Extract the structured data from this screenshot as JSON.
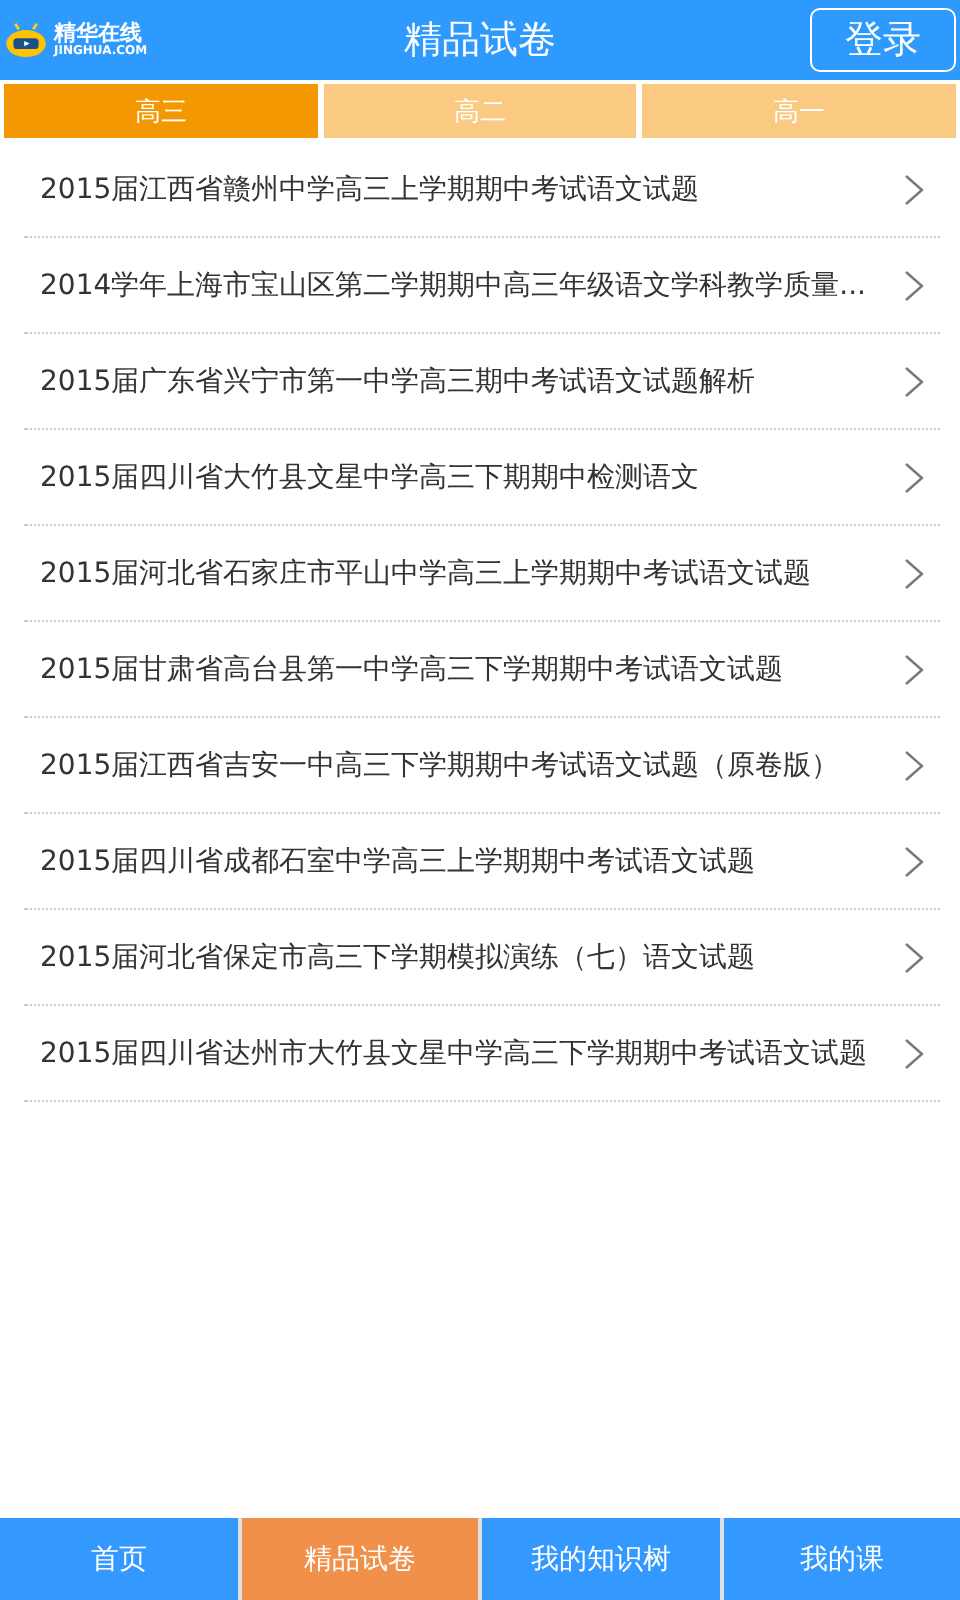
{
  "header": {
    "logo_name": "精华在线",
    "logo_domain": "JINGHUA.COM",
    "title": "精品试卷",
    "login_button": "登录"
  },
  "tabs": [
    {
      "label": "高三",
      "selected": true
    },
    {
      "label": "高二",
      "selected": false
    },
    {
      "label": "高一",
      "selected": false
    }
  ],
  "papers": [
    "2015届江西省赣州中学高三上学期期中考试语文试题",
    "2014学年上海市宝山区第二学期期中高三年级语文学科教学质量...",
    "2015届广东省兴宁市第一中学高三期中考试语文试题解析",
    "2015届四川省大竹县文星中学高三下期期中检测语文",
    "2015届河北省石家庄市平山中学高三上学期期中考试语文试题",
    "2015届甘肃省高台县第一中学高三下学期期中考试语文试题",
    "2015届江西省吉安一中高三下学期期中考试语文试题（原卷版）",
    "2015届四川省成都石室中学高三上学期期中考试语文试题",
    "2015届河北省保定市高三下学期模拟演练（七）语文试题",
    "2015届四川省达州市大竹县文星中学高三下学期期中考试语文试题"
  ],
  "bottom_nav": [
    {
      "label": "首页",
      "selected": false
    },
    {
      "label": "精品试卷",
      "selected": true
    },
    {
      "label": "我的知识树",
      "selected": false
    },
    {
      "label": "我的课",
      "selected": false
    }
  ]
}
